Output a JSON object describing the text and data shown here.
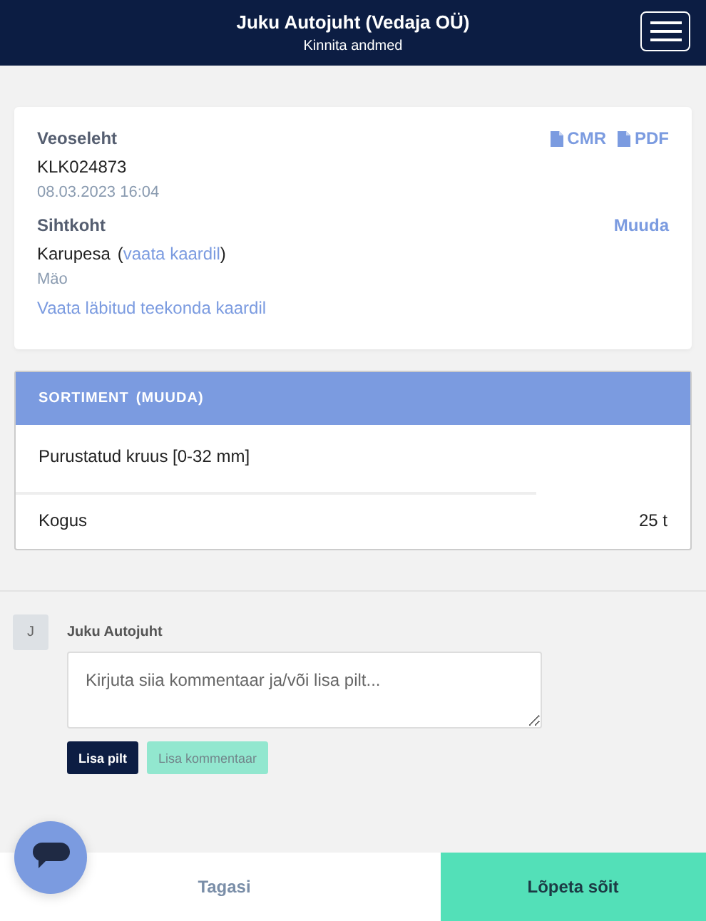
{
  "header": {
    "title": "Juku Autojuht (Vedaja OÜ)",
    "subtitle": "Kinnita andmed"
  },
  "waybill": {
    "label": "Veoseleht",
    "documents": [
      {
        "label": "CMR"
      },
      {
        "label": "PDF"
      }
    ],
    "number": "KLK024873",
    "datetime": "08.03.2023 16:04"
  },
  "destination": {
    "label": "Sihtkoht",
    "edit_link": "Muuda",
    "place": "Karupesa",
    "map_link_open": "(",
    "map_link": "vaata kaardil",
    "map_link_close": ")",
    "area": "Mäo",
    "route_link": "Vaata läbitud teekonda kaardil"
  },
  "assortment": {
    "heading": "SORTIMENT",
    "edit_link": "(MUUDA)",
    "product": "Purustatud kruus [0-32 mm]",
    "quantity_label": "Kogus",
    "quantity": "25 t"
  },
  "comment": {
    "avatar": "J",
    "author": "Juku Autojuht",
    "placeholder": "Kirjuta siia kommentaar ja/või lisa pilt...",
    "buttons": [
      {
        "label": "Lisa pilt",
        "disabled": false
      },
      {
        "label": "Lisa kommentaar",
        "disabled": true
      }
    ]
  },
  "footer": {
    "back": "Tagasi",
    "finish": "Lõpeta sõit"
  }
}
